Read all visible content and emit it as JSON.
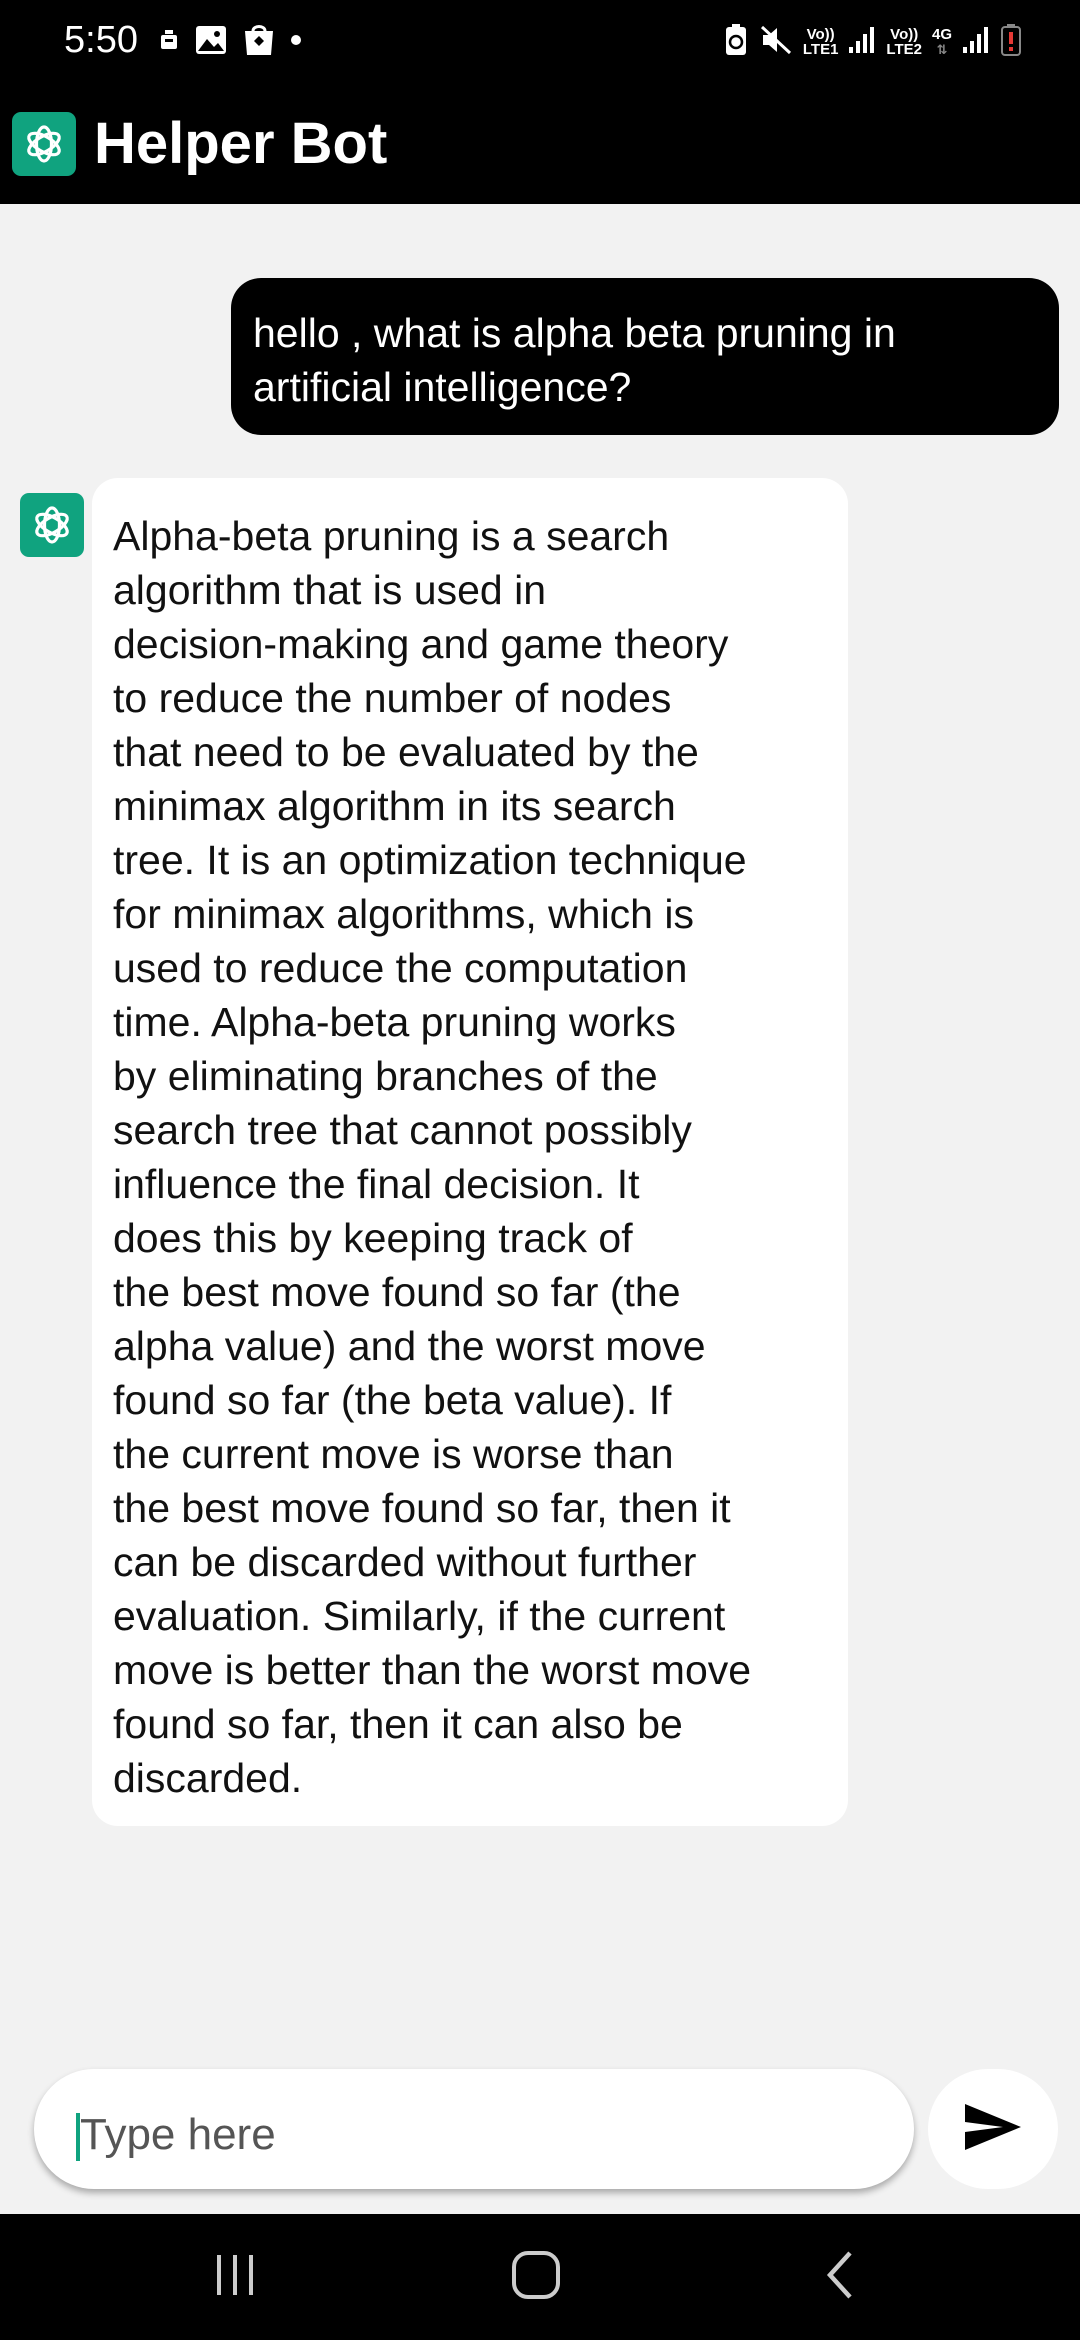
{
  "status_bar": {
    "time": "5:50",
    "left_icons": [
      "notification-icon",
      "gallery-icon",
      "store-icon",
      "dot-icon"
    ],
    "right_icons": [
      "battery-saver-icon",
      "mute-icon",
      "signal-icon",
      "signal-icon",
      "battery-low-icon"
    ],
    "sim1_label_top": "Vo))",
    "sim1_label_bottom": "LTE1",
    "sim2_label_top": "Vo))",
    "sim2_label_bottom": "LTE2",
    "network_type": "4G"
  },
  "app_bar": {
    "logo_icon": "openai-logo-icon",
    "title": "Helper Bot"
  },
  "chat": {
    "messages": [
      {
        "role": "user",
        "text": "hello , what is alpha beta pruning in artificial intelligence?"
      },
      {
        "role": "bot",
        "avatar_icon": "openai-logo-icon",
        "text": "Alpha-beta pruning is a search\nalgorithm that is used in\ndecision-making and game theory\nto reduce the number of nodes\nthat need to be evaluated by the\nminimax algorithm in its search\ntree. It is an optimization technique\nfor minimax algorithms, which is\nused to reduce the computation\ntime. Alpha-beta pruning works\nby eliminating branches of the\nsearch tree that cannot possibly\ninfluence the final decision. It\ndoes this by keeping track of\nthe best move found so far (the\nalpha value) and the worst move\nfound so far (the beta value). If\nthe current move is worse than\nthe best move found so far, then it\ncan be discarded without further\nevaluation. Similarly, if the current\nmove is better than the worst move\nfound so far, then it can also be\ndiscarded."
      }
    ]
  },
  "composer": {
    "placeholder": "Type here",
    "value": "",
    "send_icon": "send-icon"
  },
  "nav_bar": {
    "buttons": [
      "recents-icon",
      "home-icon",
      "back-icon"
    ]
  },
  "colors": {
    "accent": "#10a37f",
    "app_bar": "#000000",
    "background": "#f2f2f2",
    "user_bubble": "#000000",
    "bot_bubble": "#ffffff"
  }
}
